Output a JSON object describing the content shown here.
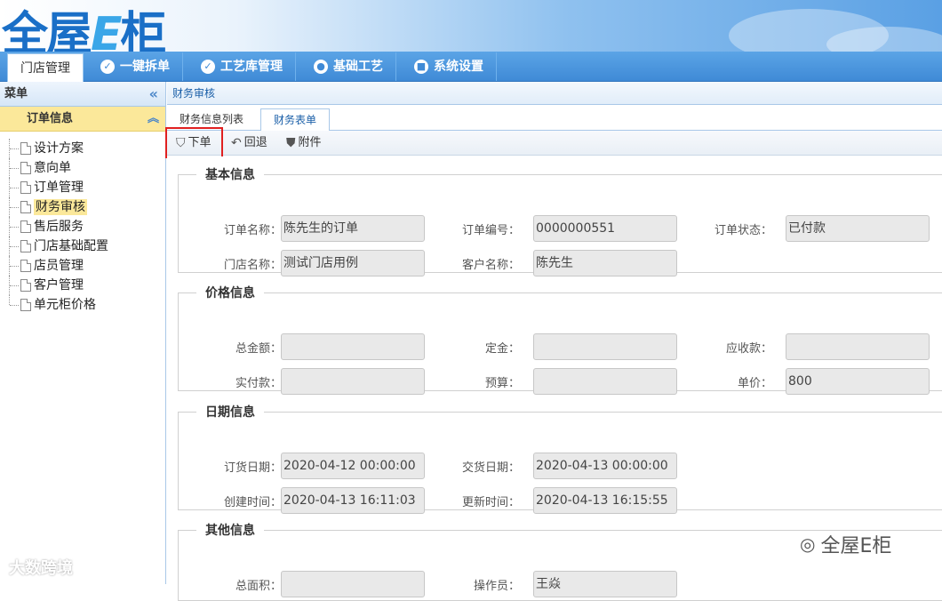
{
  "header": {
    "logo_text": "全屋",
    "logo_e": "E",
    "logo_tail": "柜"
  },
  "nav": [
    {
      "label": "门店管理",
      "active": true
    },
    {
      "label": "一键拆单"
    },
    {
      "label": "工艺库管理"
    },
    {
      "label": "基础工艺"
    },
    {
      "label": "系统设置"
    }
  ],
  "sidebar": {
    "title": "菜单",
    "collapse": "«",
    "group": "订单信息",
    "items": [
      "设计方案",
      "意向单",
      "订单管理",
      "财务审核",
      "售后服务",
      "门店基础配置",
      "店员管理",
      "客户管理",
      "单元柜价格"
    ],
    "selected": "财务审核"
  },
  "breadcrumb": "财务审核",
  "tabs": [
    "财务信息列表",
    "财务表单"
  ],
  "toolbar": [
    "下单",
    "回退",
    "附件"
  ],
  "sections": {
    "basic": {
      "title": "基本信息",
      "order_name_label": "订单名称：",
      "order_name": "陈先生的订单",
      "order_no_label": "订单编号：",
      "order_no": "0000000551",
      "order_status_label": "订单状态：",
      "order_status": "已付款",
      "store_name_label": "门店名称：",
      "store_name": "测试门店用例",
      "customer_label": "客户名称：",
      "customer": "陈先生"
    },
    "price": {
      "title": "价格信息",
      "total_label": "总金额：",
      "total": "",
      "deposit_label": "定金：",
      "deposit": "",
      "receivable_label": "应收款：",
      "receivable": "",
      "paid_label": "实付款：",
      "paid": "",
      "budget_label": "预算：",
      "budget": "",
      "unit_price_label": "单价：",
      "unit_price": "800"
    },
    "date": {
      "title": "日期信息",
      "order_date_label": "订货日期：",
      "order_date": "2020-04-12 00:00:00",
      "delivery_date_label": "交货日期：",
      "delivery_date": "2020-04-13 00:00:00",
      "created_label": "创建时间：",
      "created": "2020-04-13 16:11:03",
      "updated_label": "更新时间：",
      "updated": "2020-04-13 16:15:55"
    },
    "other": {
      "title": "其他信息",
      "area_label": "总面积：",
      "area": "",
      "operator_label": "操作员：",
      "operator": "王焱"
    }
  },
  "watermark": {
    "left": "大数跨境",
    "right": "全屋E柜"
  }
}
